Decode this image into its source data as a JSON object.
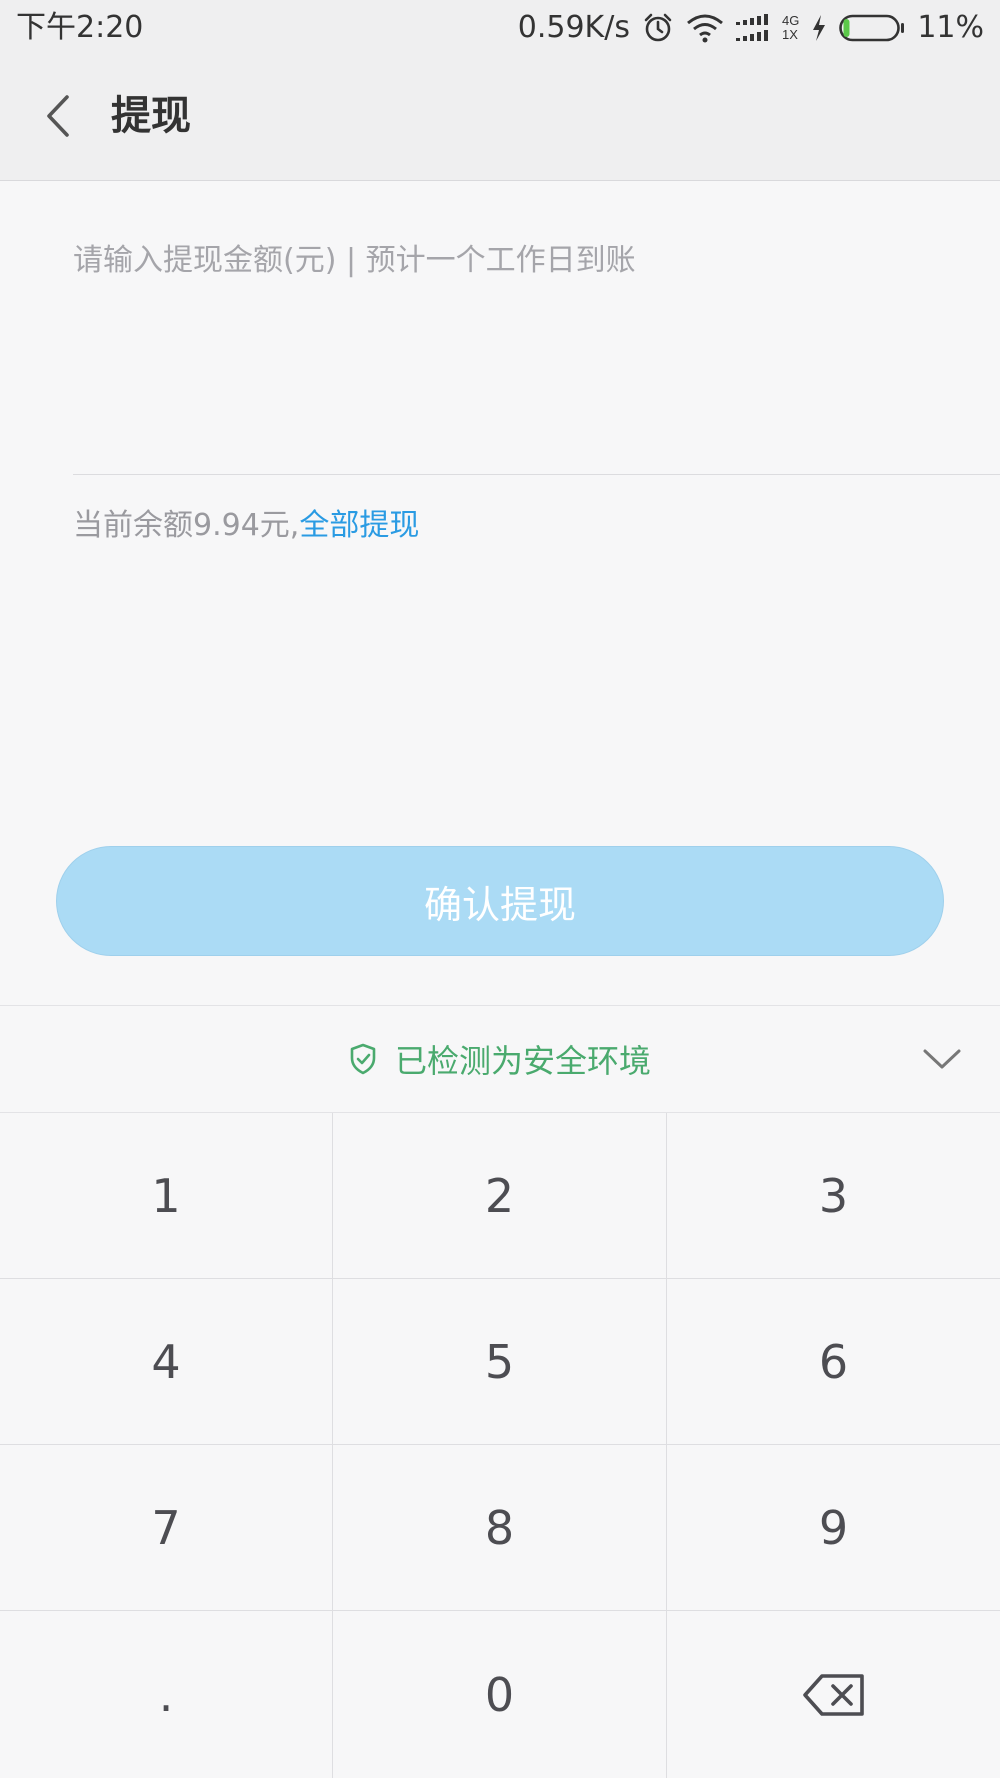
{
  "status_bar": {
    "time": "下午2:20",
    "net_speed": "0.59K/s",
    "network_top": "4G",
    "network_bottom": "1X",
    "battery_percent": "11%",
    "battery_level": 0.11,
    "icons": [
      "alarm-icon",
      "wifi-icon",
      "signal-icon",
      "charging-icon",
      "battery-icon"
    ]
  },
  "header": {
    "title": "提现",
    "back_icon": "chevron-left-icon"
  },
  "form": {
    "amount_placeholder": "请输入提现金额(元) | 预计一个工作日到账",
    "amount_value": "",
    "balance_text": "当前余额9.94元,",
    "withdraw_all_label": "全部提现",
    "confirm_label": "确认提现"
  },
  "keyboard": {
    "security_text": "已检测为安全环境",
    "security_icon": "shield-check-icon",
    "collapse_icon": "chevron-down-icon",
    "keys": [
      "1",
      "2",
      "3",
      "4",
      "5",
      "6",
      "7",
      "8",
      "9",
      ".",
      "0",
      "backspace"
    ]
  },
  "colors": {
    "accent_link": "#2a9be3",
    "confirm_button_bg": "#abdbf5",
    "security_green": "#4aaa6e",
    "battery_green": "#5cc84a"
  }
}
